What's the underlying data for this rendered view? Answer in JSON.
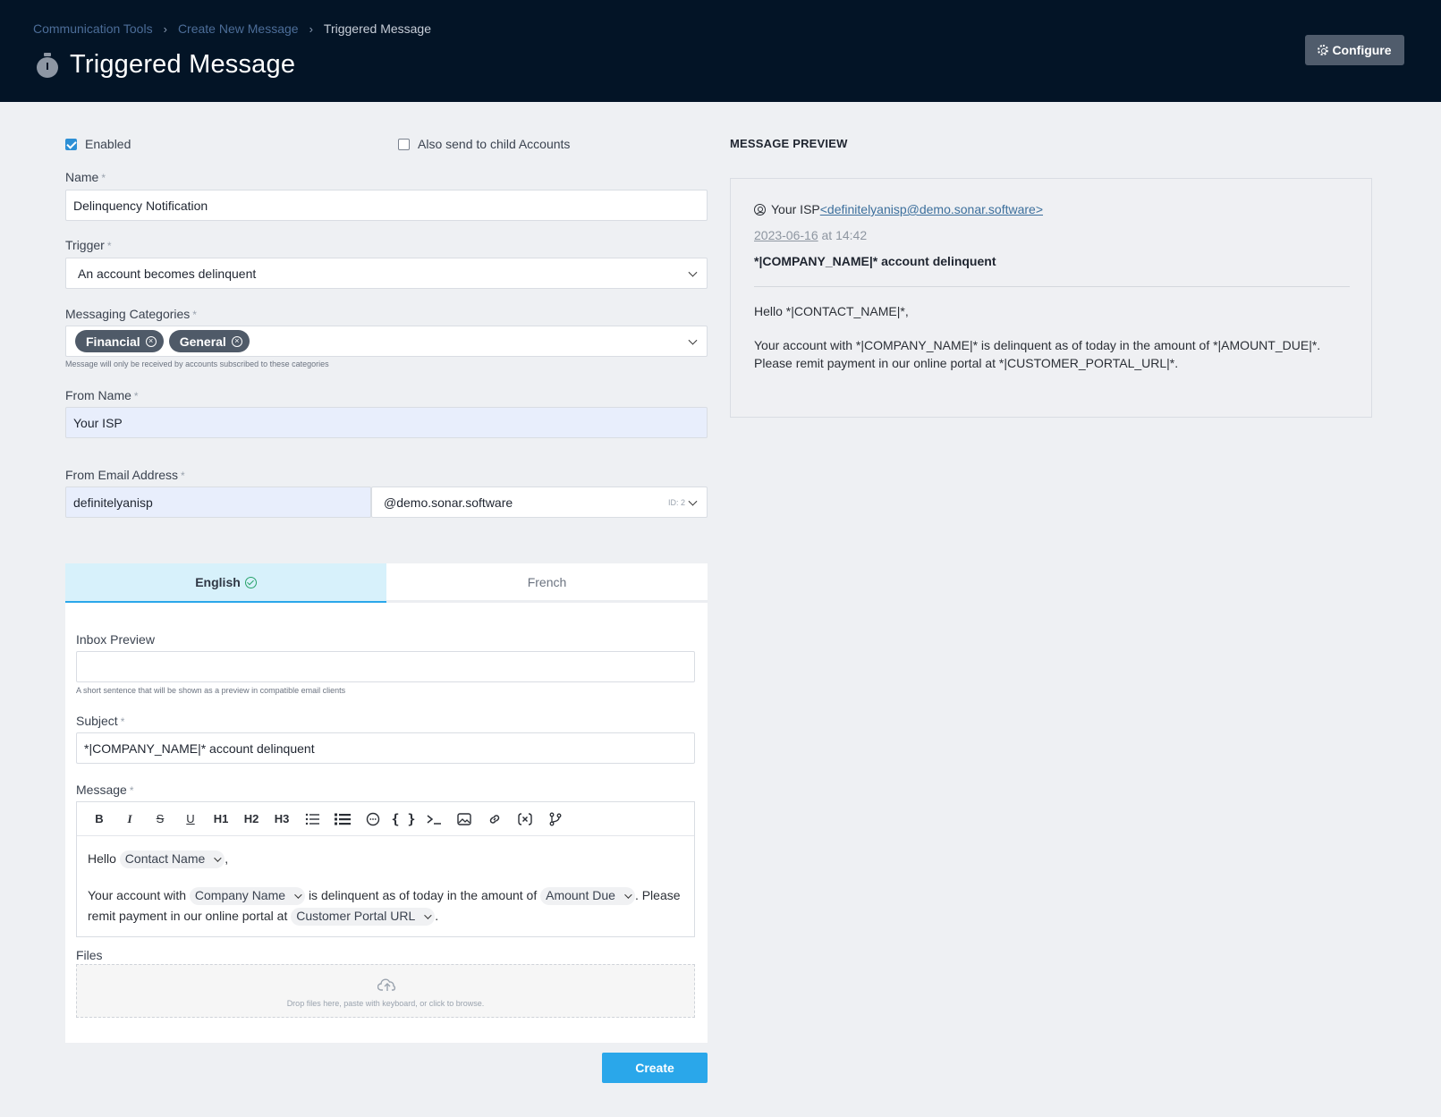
{
  "breadcrumb": [
    "Communication Tools",
    "Create New Message",
    "Triggered Message"
  ],
  "page_title": "Triggered Message",
  "configure_label": "Configure",
  "form": {
    "enabled_label": "Enabled",
    "enabled_checked": true,
    "child_accounts_label": "Also send to child Accounts",
    "child_accounts_checked": false,
    "name_label": "Name",
    "name_value": "Delinquency Notification",
    "trigger_label": "Trigger",
    "trigger_value": "An account becomes delinquent",
    "categories_label": "Messaging Categories",
    "categories": [
      "Financial",
      "General"
    ],
    "categories_help": "Message will only be received by accounts subscribed to these categories",
    "from_name_label": "From Name",
    "from_name_value": "Your ISP",
    "from_email_label": "From Email Address",
    "from_email_local": "definitelyanisp",
    "from_email_domain": "@demo.sonar.software",
    "domain_id": "ID: 2",
    "required_mark": "*"
  },
  "tabs": [
    {
      "label": "English",
      "active": true
    },
    {
      "label": "French",
      "active": false
    }
  ],
  "lang": {
    "inbox_preview_label": "Inbox Preview",
    "inbox_preview_value": "",
    "inbox_preview_help": "A short sentence that will be shown as a preview in compatible email clients",
    "subject_label": "Subject",
    "subject_value": "*|COMPANY_NAME|* account delinquent",
    "message_label": "Message",
    "toolbar": [
      "B",
      "I",
      "S",
      "U",
      "H1",
      "H2",
      "H3"
    ],
    "body_hello": "Hello",
    "var_contact": "Contact Name",
    "comma": ",",
    "body_account_with": "Your account with",
    "var_company": "Company Name",
    "body_delinquent": "is delinquent as of today in the amount of",
    "var_amount": "Amount Due",
    "body_please": ". Please",
    "body_remit": "remit payment in our online portal at",
    "var_portal": "Customer Portal URL",
    "period": ".",
    "files_label": "Files",
    "drop_text": "Drop files here, paste with keyboard, or click to browse."
  },
  "create_label": "Create",
  "preview": {
    "heading": "MESSAGE PREVIEW",
    "from_name": "Your ISP",
    "from_email": "<definitelyanisp@demo.sonar.software>",
    "date": "2023-06-16",
    "time": "at 14:42",
    "subject": "*|COMPANY_NAME|* account delinquent",
    "line1": "Hello *|CONTACT_NAME|*,",
    "line2": "Your account with *|COMPANY_NAME|* is delinquent as of today in the amount of *|AMOUNT_DUE|*. Please remit payment in our online portal at *|CUSTOMER_PORTAL_URL|*."
  },
  "colors": {
    "header_bg": "#031426",
    "accent": "#2aa7ea",
    "tag_bg": "#4f5a68",
    "success": "#27a36a"
  }
}
